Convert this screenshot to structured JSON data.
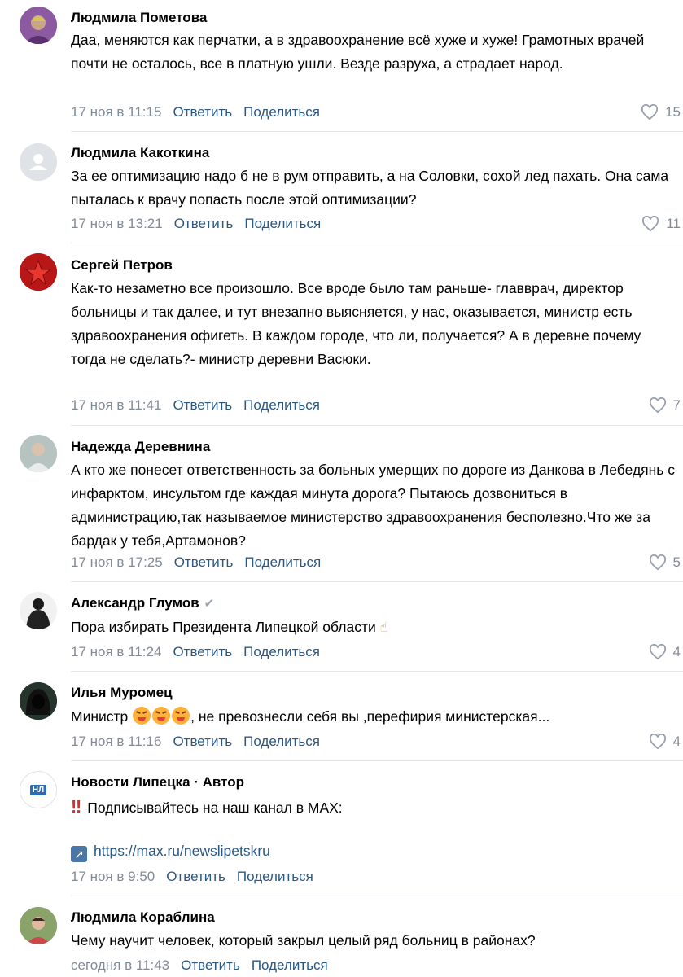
{
  "reply_label": "Ответить",
  "share_label": "Поделиться",
  "comments": [
    {
      "author": "Людмила Пометова",
      "text": "Даа, меняются как перчатки, а в здравоохранение всё хуже и хуже! Грамотных врачей почти не осталось, все в платную ушли. Везде разруха, а страдает народ.",
      "date": "17 ноя в 11:15",
      "likes": "15"
    },
    {
      "author": "Людмила Какоткина",
      "text": "За ее оптимизацию надо б не в рум отправить, а на Соловки, сохой лед пахать. Она сама пыталась к врачу попасть после этой оптимизации?",
      "date": "17 ноя в 13:21",
      "likes": "11"
    },
    {
      "author": "Сергей Петров",
      "text": "Как-то незаметно все произошло. Все вроде было там раньше- главврач, директор больницы и так далее, и тут внезапно выясняется, у нас, оказывается, министр есть здравоохранения офигеть. В каждом городе, что ли, получается? А в деревне почему тогда не сделать?- министр деревни Васюки.",
      "date": "17 ноя в 11:41",
      "likes": "7"
    },
    {
      "author": "Надежда Деревнина",
      "text": "А кто же понесет ответственность за больных умерщих по дороге из Данкова в Лебедянь с инфарктом, инсультом где каждая минута дорога? Пытаюсь дозвониться в администрацию,так называемое министерство здравоохранения бесполезно.Что же за бардак у тебя,Артамонов?",
      "date": "17 ноя в 17:25",
      "likes": "5"
    },
    {
      "author": "Александр Глумов",
      "text": "Пора избирать Президента Липецкой области",
      "emoji": "☝",
      "date": "17 ноя в 11:24",
      "likes": "4"
    },
    {
      "author": "Илья Муромец",
      "text_before": "Министр",
      "text_after": ", не превознесли себя вы ,перефирия министерская...",
      "date": "17 ноя в 11:16",
      "likes": "4"
    },
    {
      "author": "Новости Липецка · Автор",
      "avatar_text": "НЛ",
      "bang": "‼",
      "text": "Подписывайтесь на наш канал в MAX:",
      "link": "https://max.ru/newslipetskru",
      "date": "17 ноя в 9:50"
    },
    {
      "author": "Людмила Кораблина",
      "text": "Чему научит человек, который закрыл целый ряд больниц в районах?",
      "date": "сегодня в 11:43"
    }
  ],
  "colors": {
    "link": "#2a5885",
    "meta": "#818c99",
    "divider": "#e3e7ec"
  }
}
